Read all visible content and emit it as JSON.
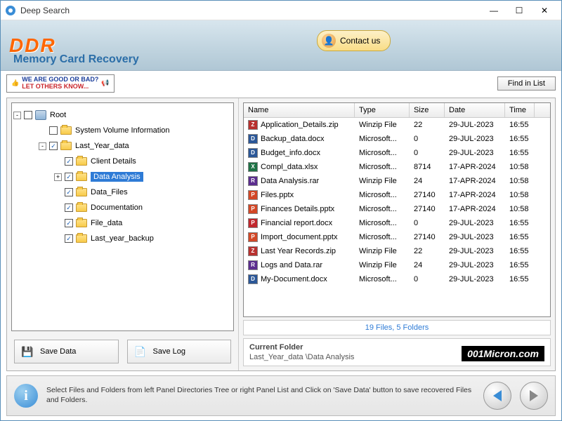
{
  "window": {
    "title": "Deep Search"
  },
  "banner": {
    "brand": "DDR",
    "subbrand": "Memory Card Recovery",
    "contact": "Contact us"
  },
  "toolbar": {
    "feedback_l1": "WE ARE GOOD OR BAD?",
    "feedback_l2": "LET OTHERS KNOW...",
    "find_in_list": "Find in List"
  },
  "tree": {
    "root": "Root",
    "items": [
      {
        "label": "System Volume Information",
        "depth": 1,
        "exp": "",
        "checked": false
      },
      {
        "label": "Last_Year_data",
        "depth": 1,
        "exp": "-",
        "checked": true
      },
      {
        "label": "Client Details",
        "depth": 2,
        "exp": "",
        "checked": true
      },
      {
        "label": "Data Analysis",
        "depth": 2,
        "exp": "+",
        "checked": true,
        "selected": true
      },
      {
        "label": "Data_Files",
        "depth": 2,
        "exp": "",
        "checked": true
      },
      {
        "label": "Documentation",
        "depth": 2,
        "exp": "",
        "checked": true
      },
      {
        "label": "File_data",
        "depth": 2,
        "exp": "",
        "checked": true
      },
      {
        "label": "Last_year_backup",
        "depth": 2,
        "exp": "",
        "checked": true
      }
    ]
  },
  "buttons": {
    "save_data": "Save Data",
    "save_log": "Save Log"
  },
  "list": {
    "headers": {
      "name": "Name",
      "type": "Type",
      "size": "Size",
      "date": "Date",
      "time": "Time"
    },
    "rows": [
      {
        "icon": "zip",
        "name": "Application_Details.zip",
        "type": "Winzip File",
        "size": "22",
        "date": "29-JUL-2023",
        "time": "16:55"
      },
      {
        "icon": "doc",
        "name": "Backup_data.docx",
        "type": "Microsoft...",
        "size": "0",
        "date": "29-JUL-2023",
        "time": "16:55"
      },
      {
        "icon": "doc",
        "name": "Budget_info.docx",
        "type": "Microsoft...",
        "size": "0",
        "date": "29-JUL-2023",
        "time": "16:55"
      },
      {
        "icon": "xls",
        "name": "Compl_data.xlsx",
        "type": "Microsoft...",
        "size": "8714",
        "date": "17-APR-2024",
        "time": "10:58"
      },
      {
        "icon": "rar",
        "name": "Data Analysis.rar",
        "type": "Winzip File",
        "size": "24",
        "date": "17-APR-2024",
        "time": "10:58"
      },
      {
        "icon": "ppt",
        "name": "Files.pptx",
        "type": "Microsoft...",
        "size": "27140",
        "date": "17-APR-2024",
        "time": "10:58"
      },
      {
        "icon": "ppt",
        "name": "Finances Details.pptx",
        "type": "Microsoft...",
        "size": "27140",
        "date": "17-APR-2024",
        "time": "10:58"
      },
      {
        "icon": "pdf",
        "name": "Financial report.docx",
        "type": "Microsoft...",
        "size": "0",
        "date": "29-JUL-2023",
        "time": "16:55"
      },
      {
        "icon": "ppt",
        "name": "Import_document.pptx",
        "type": "Microsoft...",
        "size": "27140",
        "date": "29-JUL-2023",
        "time": "16:55"
      },
      {
        "icon": "zip",
        "name": "Last Year Records.zip",
        "type": "Winzip File",
        "size": "22",
        "date": "29-JUL-2023",
        "time": "16:55"
      },
      {
        "icon": "rar",
        "name": "Logs and Data.rar",
        "type": "Winzip File",
        "size": "24",
        "date": "29-JUL-2023",
        "time": "16:55"
      },
      {
        "icon": "doc",
        "name": "My-Document.docx",
        "type": "Microsoft...",
        "size": "0",
        "date": "29-JUL-2023",
        "time": "16:55"
      }
    ]
  },
  "status": "19 Files, 5 Folders",
  "current_folder": {
    "heading": "Current Folder",
    "path": "Last_Year_data \\Data Analysis"
  },
  "watermark": "001Micron.com",
  "footer": {
    "text": "Select Files and Folders from left Panel Directories Tree or right Panel List and Click on 'Save Data' button to save recovered Files and Folders."
  }
}
